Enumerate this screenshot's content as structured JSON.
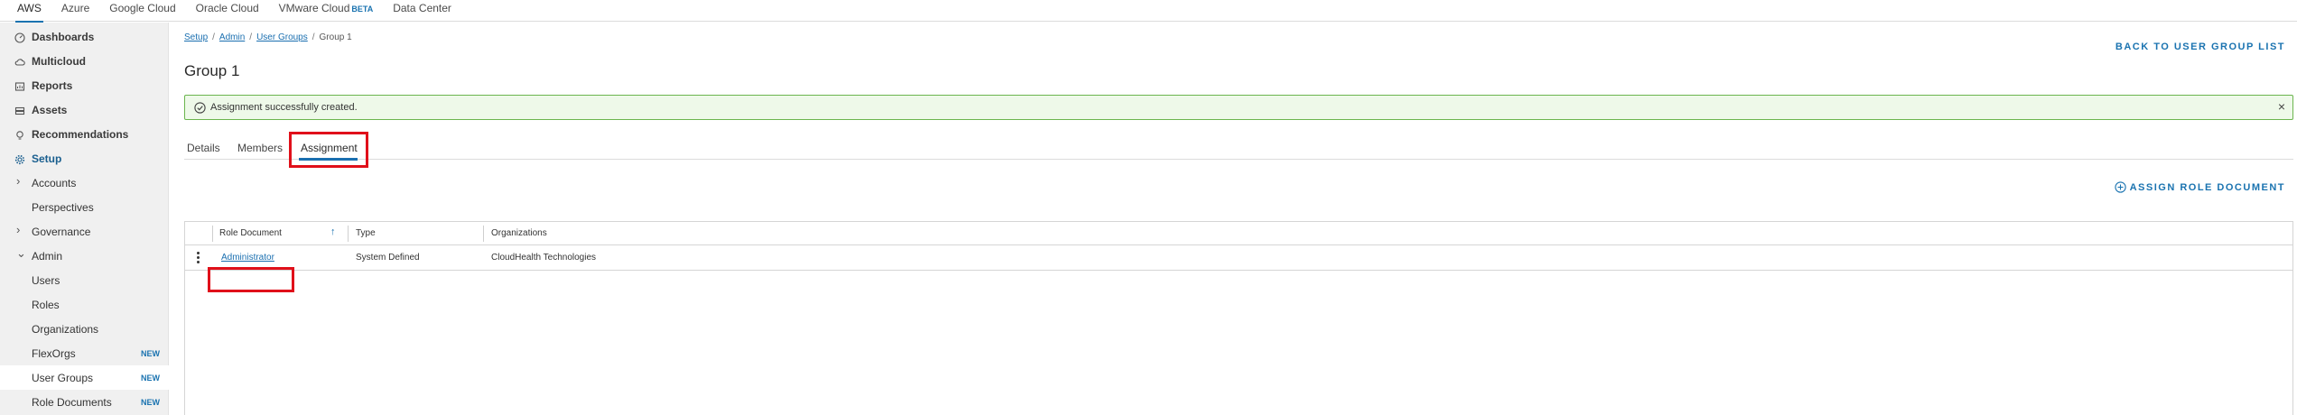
{
  "topnav": {
    "tabs": [
      {
        "label": "AWS",
        "active": true
      },
      {
        "label": "Azure"
      },
      {
        "label": "Google Cloud"
      },
      {
        "label": "Oracle Cloud"
      },
      {
        "label": "VMware Cloud",
        "badge": "BETA"
      },
      {
        "label": "Data Center"
      }
    ]
  },
  "sidebar": {
    "items": [
      {
        "label": "Dashboards",
        "icon": "dashboard-icon"
      },
      {
        "label": "Multicloud",
        "icon": "cloud-icon"
      },
      {
        "label": "Reports",
        "icon": "reports-icon"
      },
      {
        "label": "Assets",
        "icon": "assets-icon"
      },
      {
        "label": "Recommendations",
        "icon": "lightbulb-icon"
      },
      {
        "label": "Setup",
        "icon": "gear-icon"
      },
      {
        "label": "Accounts"
      },
      {
        "label": "Perspectives"
      },
      {
        "label": "Governance"
      },
      {
        "label": "Admin"
      },
      {
        "label": "Users"
      },
      {
        "label": "Roles"
      },
      {
        "label": "Organizations"
      },
      {
        "label": "FlexOrgs",
        "badge": "NEW"
      },
      {
        "label": "User Groups",
        "badge": "NEW"
      },
      {
        "label": "Role Documents",
        "badge": "NEW"
      }
    ]
  },
  "breadcrumb": {
    "setup": "Setup",
    "admin": "Admin",
    "user_groups": "User Groups",
    "current": "Group 1",
    "sep": "/"
  },
  "back_link": "BACK TO USER GROUP LIST",
  "page_title": "Group 1",
  "alert": {
    "message": "Assignment successfully created.",
    "close": "×"
  },
  "tabs": [
    "Details",
    "Members",
    "Assignment"
  ],
  "assign_button": "ASSIGN ROLE DOCUMENT",
  "table": {
    "columns": [
      "Role Document",
      "Type",
      "Organizations"
    ],
    "sort_indicator": "↑",
    "rows": [
      {
        "role_document": "Administrator",
        "type": "System Defined",
        "organizations": "CloudHealth Technologies"
      }
    ]
  },
  "colors": {
    "accent": "#1a73b0",
    "success_border": "#6bb54e",
    "success_bg": "#eef9e9",
    "highlight": "#e0101a"
  }
}
